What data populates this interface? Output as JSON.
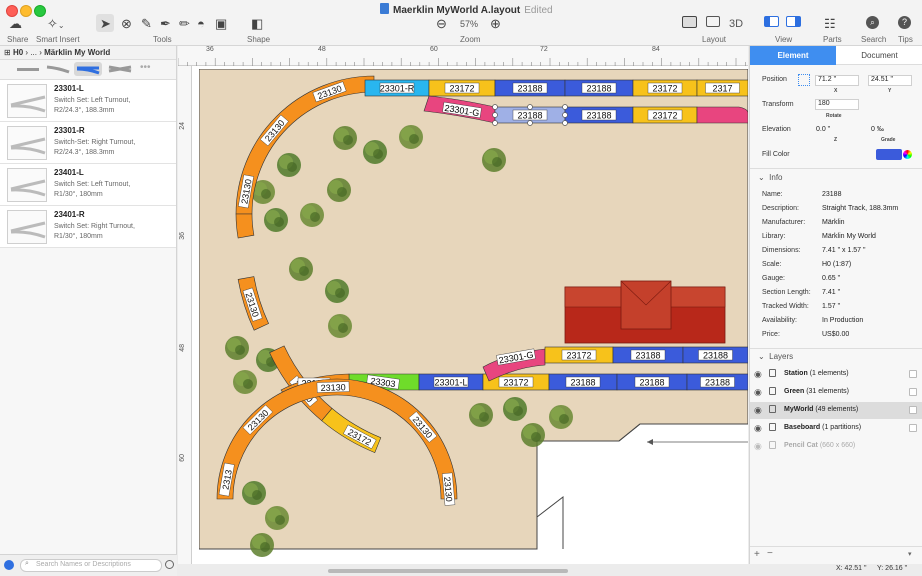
{
  "window": {
    "title": "Maerklin MyWorld A.layout",
    "edited": "Edited"
  },
  "toolbar": {
    "share": "Share",
    "smart_insert": "Smart Insert",
    "tools": "Tools",
    "shape": "Shape",
    "zoom": "Zoom",
    "zoom_value": "57%",
    "layout": "Layout",
    "view_3d": "3D",
    "view": "View",
    "parts": "Parts",
    "search": "Search",
    "tips": "Tips"
  },
  "library": {
    "breadcrumb_root": "H0",
    "breadcrumb_mid": "...",
    "breadcrumb_current": "Märklin My World",
    "search_placeholder": "Search Names or Descriptions",
    "parts": [
      {
        "name": "23301-L",
        "desc1": "Switch Set: Left Turnout,",
        "desc2": "R2/24.3°, 188.3mm"
      },
      {
        "name": "23301-R",
        "desc1": "Switch-Set: Right Turnout,",
        "desc2": "R2/24.3°, 188.3mm"
      },
      {
        "name": "23401-L",
        "desc1": "Switch Set: Left Turnout,",
        "desc2": "R1/30°, 180mm"
      },
      {
        "name": "23401-R",
        "desc1": "Switch Set: Right Turnout,",
        "desc2": "R1/30°, 180mm"
      }
    ]
  },
  "rulers": {
    "top": [
      "36",
      "48",
      "60",
      "72",
      "84"
    ],
    "left": [
      "24",
      "36",
      "48",
      "60",
      "72"
    ]
  },
  "layout": {
    "track_labels": {
      "t1": "23130",
      "t2": "23301-R",
      "t3": "23172",
      "t4": "23188",
      "t5": "23188",
      "t6": "23172",
      "t7": "2317",
      "t8": "23301-G",
      "t9": "23188",
      "t10": "23188",
      "t11": "23172",
      "t12": "23130",
      "t13": "23130",
      "t14": "23130",
      "t15": "23130",
      "t16": "23172",
      "t17": "23303",
      "t18": "23130",
      "t19": "23301-L",
      "t20": "23172",
      "t21": "23188",
      "t22": "23188",
      "t23": "23301-G",
      "t24": "23172",
      "t25": "23188",
      "t26": "23188",
      "t27": "23130",
      "t28": "23130",
      "t29": "23130",
      "t30": "2313",
      "t31": "23130"
    }
  },
  "inspector": {
    "tab_element": "Element",
    "tab_document": "Document",
    "position_label": "Position",
    "position_x": "71.2 \"",
    "position_y": "24.51 \"",
    "x_label": "X",
    "y_label": "Y",
    "transform_label": "Transform",
    "rotate_value": "180",
    "rotate_label": "Rotate",
    "elevation_label": "Elevation",
    "elevation_z": "0.0 \"",
    "grade_value": "0 ‰",
    "z_label": "Z",
    "grade_label": "Grade",
    "fill_color_label": "Fill Color",
    "fill_color": "#3b5bdb",
    "info_header": "Info",
    "info": [
      {
        "k": "Name:",
        "v": "23188"
      },
      {
        "k": "Description:",
        "v": "Straight Track, 188.3mm"
      },
      {
        "k": "Manufacturer:",
        "v": "Märklin"
      },
      {
        "k": "Library:",
        "v": "Märklin My World"
      },
      {
        "k": "Dimensions:",
        "v": "7.41 \" x 1.57 \""
      },
      {
        "k": "Scale:",
        "v": "H0 (1:87)"
      },
      {
        "k": "Gauge:",
        "v": "0.65 \""
      },
      {
        "k": "Section Length:",
        "v": "7.41 \""
      },
      {
        "k": "Tracked Width:",
        "v": "1.57 \""
      },
      {
        "k": "Availability:",
        "v": "In Production"
      },
      {
        "k": "Price:",
        "v": "US$0.00"
      }
    ],
    "layers_header": "Layers",
    "layers": [
      {
        "name": "Station",
        "count": "(1 elements)"
      },
      {
        "name": "Green",
        "count": "(31 elements)"
      },
      {
        "name": "MyWorld",
        "count": "(49 elements)"
      },
      {
        "name": "Baseboard",
        "count": "(1 partitions)"
      },
      {
        "name": "Pencil Cat",
        "count": "(660 x 660)"
      }
    ]
  },
  "status": {
    "x": "X: 42.51 \"",
    "y": "Y: 26.16 \""
  },
  "colors": {
    "accent": "#3f8ef0",
    "track_orange": "#f5901e",
    "track_blue": "#3b5bdb",
    "track_yellow": "#f7c21b",
    "track_pink": "#e8457f",
    "track_green": "#6fdc2a",
    "track_cyan": "#29b6ef",
    "baseboard": "#e7d6bb",
    "building": "#b4291b"
  }
}
